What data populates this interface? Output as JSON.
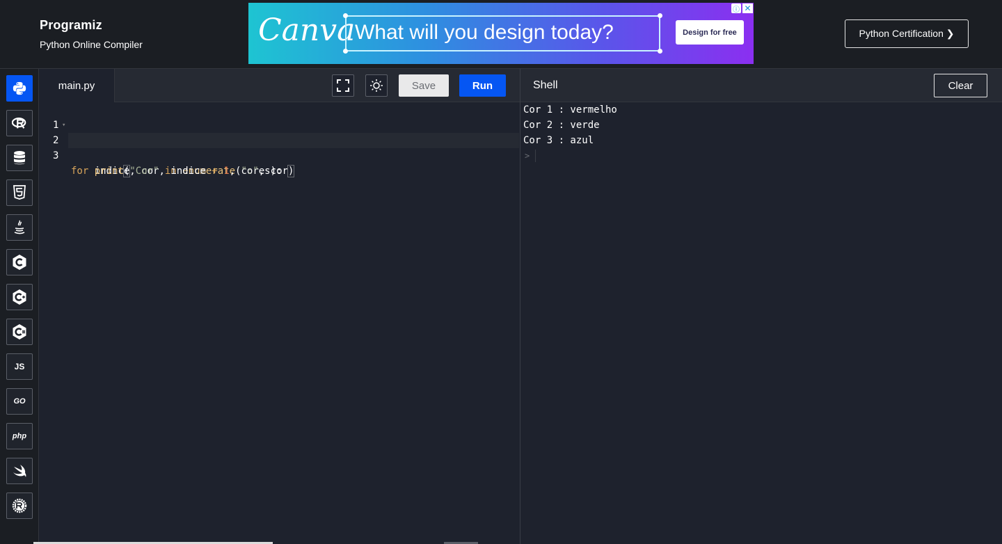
{
  "header": {
    "brand_name": "Programiz",
    "brand_subtitle": "Python Online Compiler",
    "certification_label": "Python Certification ❯"
  },
  "ad": {
    "logo": "Canva",
    "headline": "What will you design today?",
    "cta": "Design for free",
    "info_icon": "ⓘ",
    "close_icon": "✕"
  },
  "sidebar": {
    "items": [
      {
        "name": "python",
        "icon": "python-icon",
        "label": "",
        "active": true
      },
      {
        "name": "r",
        "icon": "r-icon",
        "label": ""
      },
      {
        "name": "sql",
        "icon": "database-icon",
        "label": ""
      },
      {
        "name": "html",
        "icon": "html5-icon",
        "label": ""
      },
      {
        "name": "java",
        "icon": "java-icon",
        "label": ""
      },
      {
        "name": "c",
        "icon": "c-icon",
        "label": ""
      },
      {
        "name": "cpp",
        "icon": "cpp-icon",
        "label": ""
      },
      {
        "name": "csharp",
        "icon": "csharp-icon",
        "label": ""
      },
      {
        "name": "javascript",
        "icon": "js-icon",
        "label": "JS"
      },
      {
        "name": "go",
        "icon": "go-icon",
        "label": "GO"
      },
      {
        "name": "php",
        "icon": "php-icon",
        "label": "php"
      },
      {
        "name": "swift",
        "icon": "swift-icon",
        "label": ""
      },
      {
        "name": "rust",
        "icon": "rust-icon",
        "label": ""
      }
    ]
  },
  "editor": {
    "file_tab": "main.py",
    "save_label": "Save",
    "run_label": "Run",
    "line_numbers": [
      "1",
      "2",
      "3"
    ],
    "lines": [
      "cores = [\"vermelho\", \"verde\", \"azul\"]",
      "for indice, cor in enumerate(cores):",
      "    print(\"Cor\", indice + 1, \":\", cor)"
    ]
  },
  "shell": {
    "title": "Shell",
    "clear_label": "Clear",
    "output": [
      "Cor 1 : vermelho",
      "Cor 2 : verde",
      "Cor 3 : azul"
    ],
    "prompt": ">"
  },
  "colors": {
    "accent": "#0556f3",
    "background": "#1e222d",
    "keyword": "#d9a55b",
    "string": "#a9b49a",
    "number": "#e07a4f"
  }
}
